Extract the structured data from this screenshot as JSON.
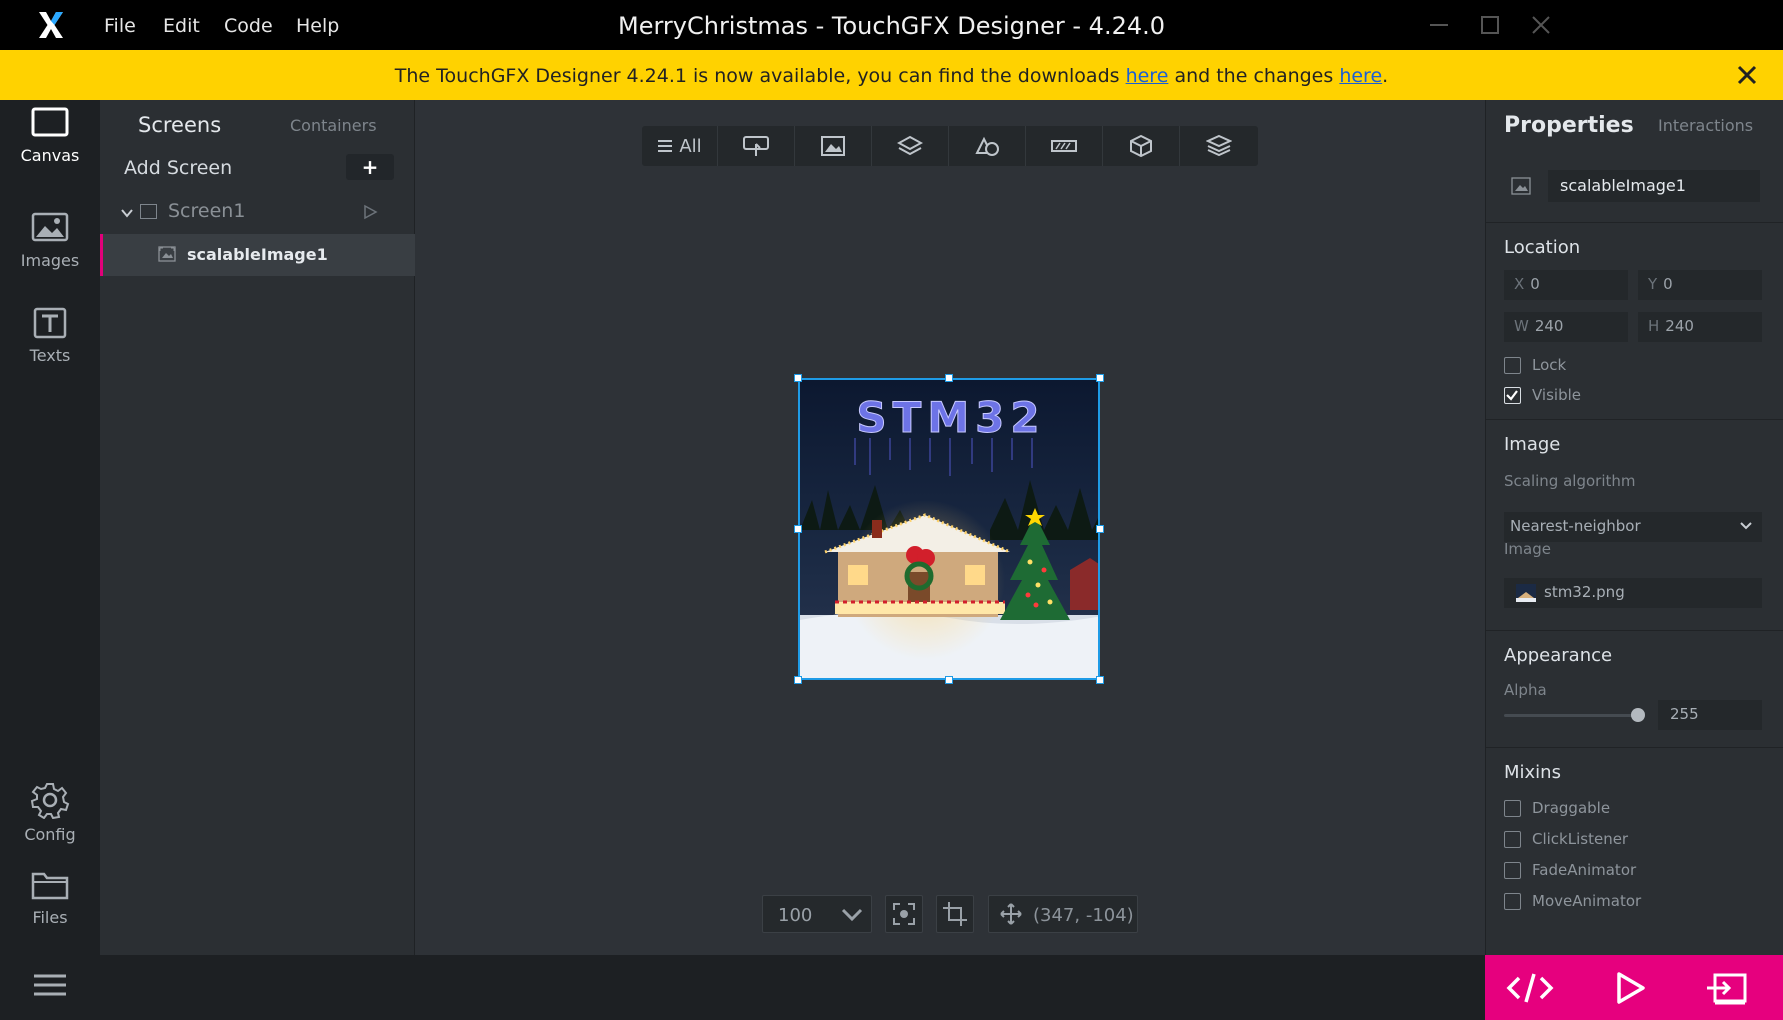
{
  "window": {
    "title": "MerryChristmas - TouchGFX Designer - 4.24.0",
    "menu": [
      "File",
      "Edit",
      "Code",
      "Help"
    ]
  },
  "banner": {
    "text_before": "The TouchGFX Designer 4.24.1 is now available, you can find the downloads ",
    "link1": "here",
    "text_middle": " and the changes ",
    "link2": "here",
    "text_after": "."
  },
  "leftnav": {
    "items": [
      {
        "label": "Canvas",
        "icon": "canvas-icon",
        "active": true
      },
      {
        "label": "Images",
        "icon": "image-icon"
      },
      {
        "label": "Texts",
        "icon": "text-icon"
      },
      {
        "label": "Config",
        "icon": "gear-icon"
      },
      {
        "label": "Files",
        "icon": "folder-icon"
      }
    ]
  },
  "screens_panel": {
    "tab_screens": "Screens",
    "tab_containers": "Containers",
    "add_screen": "Add Screen",
    "add_button": "+",
    "screen_name": "Screen1",
    "widget_name": "scalableImage1"
  },
  "canvas": {
    "toolbar_all": "All",
    "stage_text": "STM32",
    "zoom": "100",
    "coords": "(347, -104)"
  },
  "properties": {
    "tab_properties": "Properties",
    "tab_interactions": "Interactions",
    "widget_name": "scalableImage1",
    "location_title": "Location",
    "x_key": "X",
    "x": "0",
    "y_key": "Y",
    "y": "0",
    "w_key": "W",
    "w": "240",
    "h_key": "H",
    "h": "240",
    "lock_label": "Lock",
    "lock_checked": false,
    "visible_label": "Visible",
    "visible_checked": true,
    "image_title": "Image",
    "scaling_label": "Scaling algorithm",
    "scaling_value": "Nearest-neighbor",
    "image_label": "Image",
    "image_value": "stm32.png",
    "appearance_title": "Appearance",
    "alpha_label": "Alpha",
    "alpha_value": "255",
    "alpha_fraction": 1.0,
    "mixins_title": "Mixins",
    "mixins": [
      "Draggable",
      "ClickListener",
      "FadeAnimator",
      "MoveAnimator"
    ]
  },
  "colors": {
    "accent": "#e6007e",
    "banner": "#ffd200",
    "selection": "#1e9be6"
  }
}
